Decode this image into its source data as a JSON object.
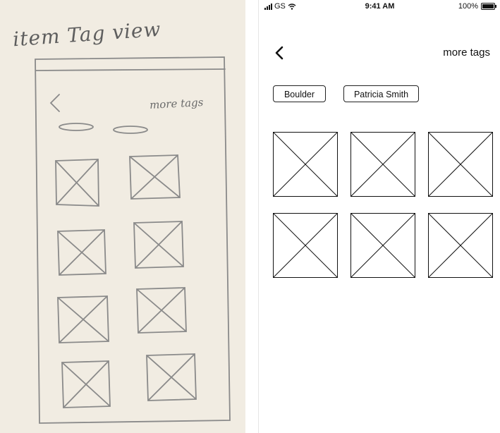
{
  "sketch": {
    "title": "item Tag view",
    "more_tags": "more tags",
    "colors": {
      "paper": "#f1ece2",
      "pencil": "#6a6a6a"
    }
  },
  "status_bar": {
    "carrier": "GS",
    "time": "9:41 AM",
    "battery": "100%",
    "battery_level": 1.0,
    "icons": [
      "signal-icon",
      "wifi-icon",
      "battery-icon"
    ]
  },
  "nav": {
    "back_icon": "chevron-left-icon",
    "more_tags": "more tags"
  },
  "tags": [
    {
      "label": "Boulder"
    },
    {
      "label": "Patricia Smith"
    }
  ],
  "grid": {
    "items": [
      {
        "icon": "image-placeholder-icon"
      },
      {
        "icon": "image-placeholder-icon"
      },
      {
        "icon": "image-placeholder-icon"
      },
      {
        "icon": "image-placeholder-icon"
      },
      {
        "icon": "image-placeholder-icon"
      },
      {
        "icon": "image-placeholder-icon"
      }
    ]
  }
}
